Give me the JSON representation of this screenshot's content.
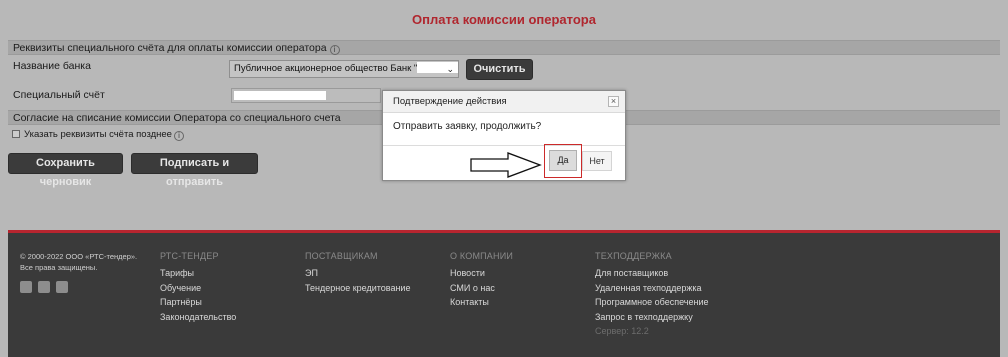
{
  "page": {
    "title": "Оплата комиссии оператора"
  },
  "requisites": {
    "section_title": "Реквизиты специального счёта для оплаты комиссии оператора",
    "bank_label": "Название банка",
    "bank_value": "Публичное акционерное общество Банк \"",
    "clear_button": "Очистить",
    "account_label": "Специальный счёт"
  },
  "consent": {
    "section_title": "Согласие на списание комиссии Оператора со специального счета",
    "checkbox_label": "Указать реквизиты счёта позднее"
  },
  "actions": {
    "save_draft": "Сохранить черновик",
    "sign_send": "Подписать и отправить"
  },
  "modal": {
    "title": "Подтверждение действия",
    "message": "Отправить заявку, продолжить?",
    "yes": "Да",
    "no": "Нет",
    "close_symbol": "×"
  },
  "footer": {
    "copyright_line1": "© 2000-2022 ООО «РТС-тендер».",
    "copyright_line2": "Все права защищены.",
    "columns": [
      {
        "heading": "РТС-ТЕНДЕР",
        "links": [
          "Тарифы",
          "Обучение",
          "Партнёры",
          "Законодательство"
        ]
      },
      {
        "heading": "ПОСТАВЩИКАМ",
        "links": [
          "ЭП",
          "Тендерное кредитование"
        ]
      },
      {
        "heading": "О КОМПАНИИ",
        "links": [
          "Новости",
          "СМИ о нас",
          "Контакты"
        ]
      },
      {
        "heading": "ТЕХПОДДЕРЖКА",
        "links": [
          "Для поставщиков",
          "Удаленная техподдержка",
          "Программное обеспечение",
          "Запрос в техподдержку"
        ]
      }
    ],
    "server": "Сервер: 12.2"
  },
  "colors": {
    "accent_red": "#b0262e",
    "footer_bg": "#3a3a3a",
    "highlight": "#cc2a2a"
  }
}
